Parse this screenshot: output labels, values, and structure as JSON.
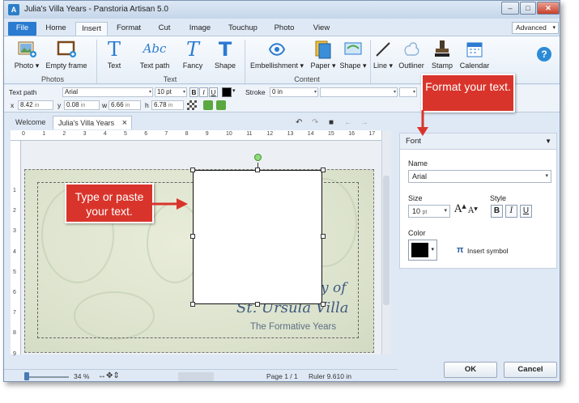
{
  "window": {
    "title": "Julia's Villa Years - Panstoria Artisan 5.0",
    "min_glyph": "–",
    "max_glyph": "□",
    "close_glyph": "✕"
  },
  "menu_tabs": [
    "File",
    "Home",
    "Insert",
    "Format",
    "Cut",
    "Image",
    "Touchup",
    "Photo",
    "View"
  ],
  "active_tab": "Insert",
  "advanced_select": "Advanced",
  "ribbon": {
    "photos": {
      "label": "Photos",
      "photo": "Photo",
      "empty_frame": "Empty frame"
    },
    "text": {
      "label": "Text",
      "text": "Text",
      "text_path": "Text path",
      "fancy": "Fancy",
      "shape": "Shape"
    },
    "content": {
      "label": "Content",
      "embellishment": "Embellishment",
      "paper": "Paper",
      "shape": "Shape"
    },
    "other": {
      "line": "Line",
      "outliner": "Outliner",
      "stamp": "Stamp",
      "calendar": "Calendar"
    },
    "help": "?",
    "glyphs": {
      "text": "T",
      "text_path": "Abc",
      "fancy": "T",
      "shape": "T"
    }
  },
  "properties": {
    "text_path_label": "Text path",
    "font": "Arial",
    "size": "10 pt",
    "bold": "B",
    "italic": "I",
    "underline": "U",
    "stroke_label": "Stroke",
    "stroke_value": "0 in",
    "x_label": "x",
    "x_value": "8.42",
    "y_label": "y",
    "y_value": "0.08",
    "w_label": "w",
    "w_value": "6.66",
    "h_label": "h",
    "h_value": "6.78",
    "unit": "in"
  },
  "doc_tabs": {
    "welcome": "Welcome",
    "current": "Julia's Villa Years",
    "close": "×"
  },
  "doc_tools": {
    "undo": "↶",
    "redo": "↷",
    "save": "■",
    "back": "←",
    "forward": "→"
  },
  "ruler": {
    "h_ticks": [
      "0",
      "1",
      "2",
      "3",
      "4",
      "5",
      "6",
      "7",
      "8",
      "9",
      "10",
      "11",
      "12",
      "13",
      "14",
      "15",
      "16",
      "17"
    ],
    "v_ticks": [
      "1",
      "2",
      "3",
      "4",
      "5",
      "6",
      "7",
      "8",
      "9"
    ]
  },
  "page_text": {
    "line1": "y of",
    "line2": "St. Ursula Villa",
    "line3": "The Formative Years"
  },
  "status": {
    "zoom": "34 %",
    "tools": "↔✥⇕",
    "page": "Page 1 / 1",
    "ruler": "Ruler 9.610 in"
  },
  "font_panel": {
    "header": "Font",
    "name_label": "Name",
    "name_value": "Arial",
    "size_label": "Size",
    "size_value": "10",
    "size_unit": "pt",
    "style_label": "Style",
    "bold": "B",
    "italic": "I",
    "underline": "U",
    "grow": "A",
    "shrink": "A",
    "color_label": "Color",
    "insert_symbol": "Insert symbol",
    "pi": "π",
    "color_value": "#000000"
  },
  "buttons": {
    "ok": "OK",
    "cancel": "Cancel"
  },
  "callouts": {
    "format": "Format your text.",
    "type": "Type or paste your text."
  },
  "colors": {
    "accent": "#2b7bd0",
    "callout": "#d9342b",
    "page_text": "#3f5a80"
  }
}
